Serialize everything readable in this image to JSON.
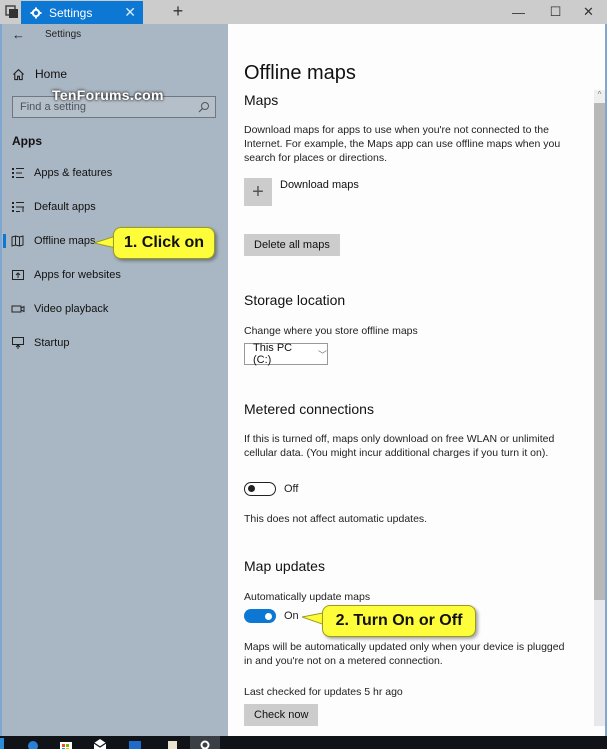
{
  "window": {
    "tab_title": "Settings",
    "tab_close": "✕",
    "new_tab": "+",
    "minimize": "—",
    "maximize": "☐",
    "close": "✕"
  },
  "sidebar": {
    "back": "←",
    "app_title": "Settings",
    "home_label": "Home",
    "watermark": "TenForums.com",
    "search_placeholder": "Find a setting",
    "section_label": "Apps",
    "items": [
      {
        "label": "Apps & features",
        "icon": "list-icon"
      },
      {
        "label": "Default apps",
        "icon": "default-apps-icon"
      },
      {
        "label": "Offline maps",
        "icon": "map-icon",
        "active": true
      },
      {
        "label": "Apps for websites",
        "icon": "open-in-app-icon"
      },
      {
        "label": "Video playback",
        "icon": "video-icon"
      },
      {
        "label": "Startup",
        "icon": "startup-icon"
      }
    ]
  },
  "content": {
    "page_title": "Offline maps",
    "maps": {
      "heading": "Maps",
      "description": "Download maps for apps to use when you're not connected to the Internet. For example, the Maps app can use offline maps when you search for places or directions.",
      "download_label": "Download maps",
      "delete_button": "Delete all maps"
    },
    "storage": {
      "heading": "Storage location",
      "description": "Change where you store offline maps",
      "selected": "This PC (C:)"
    },
    "metered": {
      "heading": "Metered connections",
      "description": "If this is turned off, maps only download on free WLAN or unlimited cellular data. (You might incur additional charges if you turn it on).",
      "toggle_state": "Off",
      "note": "This does not affect automatic updates."
    },
    "updates": {
      "heading": "Map updates",
      "toggle_caption": "Automatically update maps",
      "toggle_state": "On",
      "description": "Maps will be automatically updated only when your device is plugged in and you're not on a metered connection.",
      "last_checked": "Last checked for updates 5 hr ago",
      "check_button": "Check now"
    }
  },
  "callouts": {
    "step1": "1. Click on",
    "step2": "2. Turn On or Off"
  },
  "colors": {
    "accent": "#0c78d4",
    "callout": "#fdfd3a",
    "sidebar_bg": "#a9b6c3"
  }
}
